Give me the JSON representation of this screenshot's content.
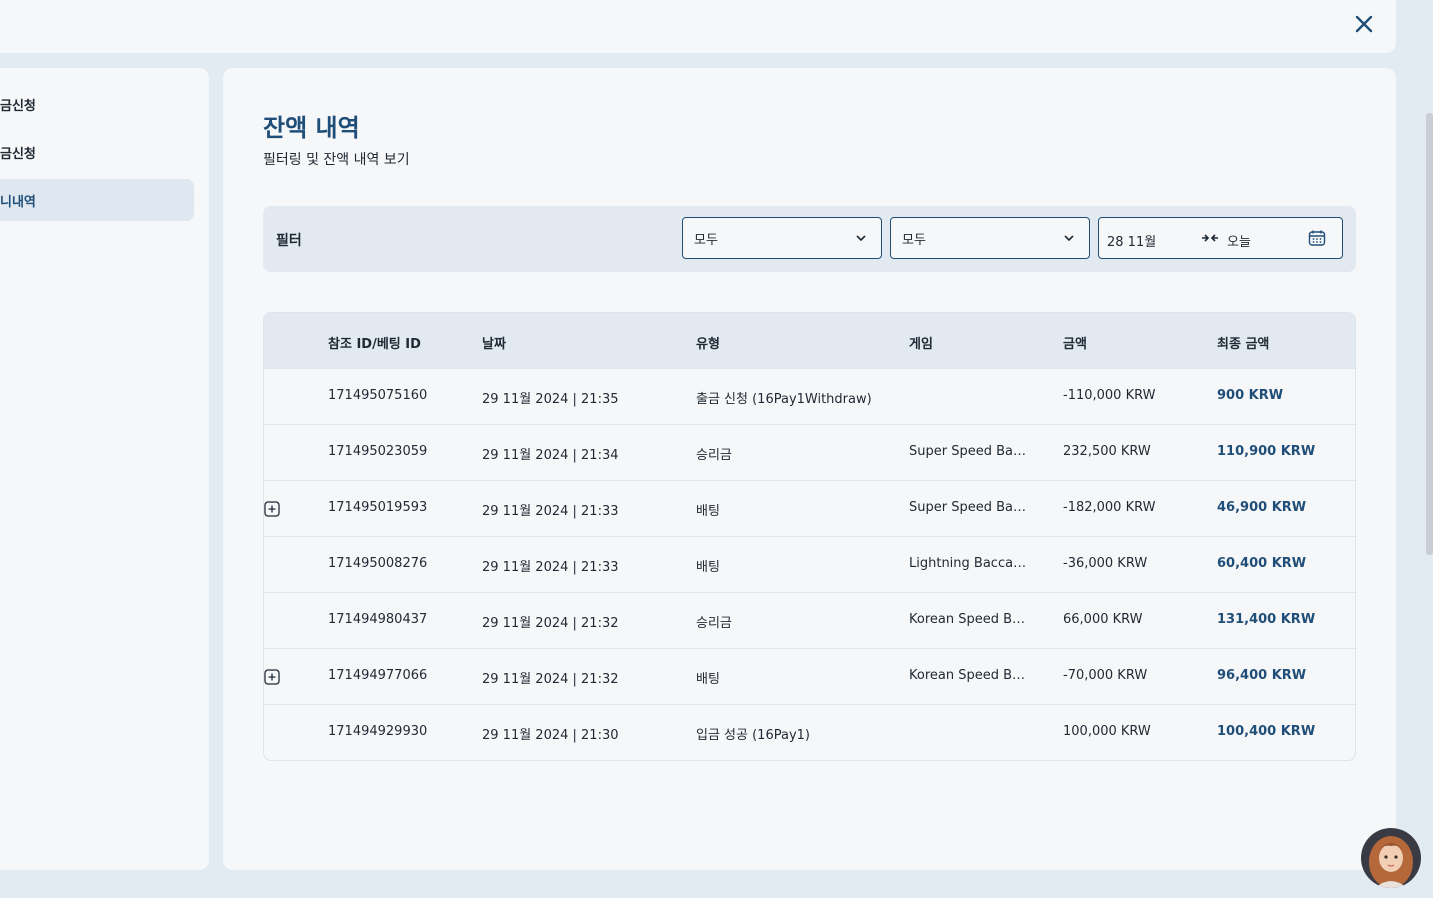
{
  "sidebar": {
    "items": [
      {
        "label": "금신청"
      },
      {
        "label": "금신청"
      },
      {
        "label": "니내역"
      }
    ]
  },
  "page": {
    "title": "잔액 내역",
    "subtitle": "필터링 및 잔액 내역 보기"
  },
  "filter": {
    "label": "필터",
    "select1": "모두",
    "select2": "모두",
    "date_from": "28 11월",
    "date_to": "오늘"
  },
  "table": {
    "headers": [
      "참조 ID/베팅 ID",
      "날짜",
      "유형",
      "게임",
      "금액",
      "최종 금액"
    ],
    "rows": [
      {
        "ref": "171495075160",
        "date": "29 11월 2024 | 21:35",
        "type": "출금 신청 (16Pay1Withdraw)",
        "game": "",
        "amount": "-110,000 KRW",
        "final": "900 KRW",
        "expandable": false
      },
      {
        "ref": "171495023059",
        "date": "29 11월 2024 | 21:34",
        "type": "승리금",
        "game": "Super Speed Ba…",
        "amount": "232,500 KRW",
        "final": "110,900 KRW",
        "expandable": false
      },
      {
        "ref": "171495019593",
        "date": "29 11월 2024 | 21:33",
        "type": "배팅",
        "game": "Super Speed Ba…",
        "amount": "-182,000 KRW",
        "final": "46,900 KRW",
        "expandable": true
      },
      {
        "ref": "171495008276",
        "date": "29 11월 2024 | 21:33",
        "type": "배팅",
        "game": "Lightning Bacca…",
        "amount": "-36,000 KRW",
        "final": "60,400 KRW",
        "expandable": false
      },
      {
        "ref": "171494980437",
        "date": "29 11월 2024 | 21:32",
        "type": "승리금",
        "game": "Korean Speed B…",
        "amount": "66,000 KRW",
        "final": "131,400 KRW",
        "expandable": false
      },
      {
        "ref": "171494977066",
        "date": "29 11월 2024 | 21:32",
        "type": "배팅",
        "game": "Korean Speed B…",
        "amount": "-70,000 KRW",
        "final": "96,400 KRW",
        "expandable": true
      },
      {
        "ref": "171494929930",
        "date": "29 11월 2024 | 21:30",
        "type": "입금 성공 (16Pay1)",
        "game": "",
        "amount": "100,000 KRW",
        "final": "100,400 KRW",
        "expandable": false
      }
    ]
  },
  "colors": {
    "accent": "#1f4e78",
    "page_bg": "#e3ebf2",
    "panel_bg": "#f6f7f9"
  },
  "icons": {
    "close": "close-icon",
    "chevron": "chevron-down-icon",
    "arrows": "arrows-inward-icon",
    "calendar": "calendar-icon",
    "expand": "plus-square-icon"
  }
}
